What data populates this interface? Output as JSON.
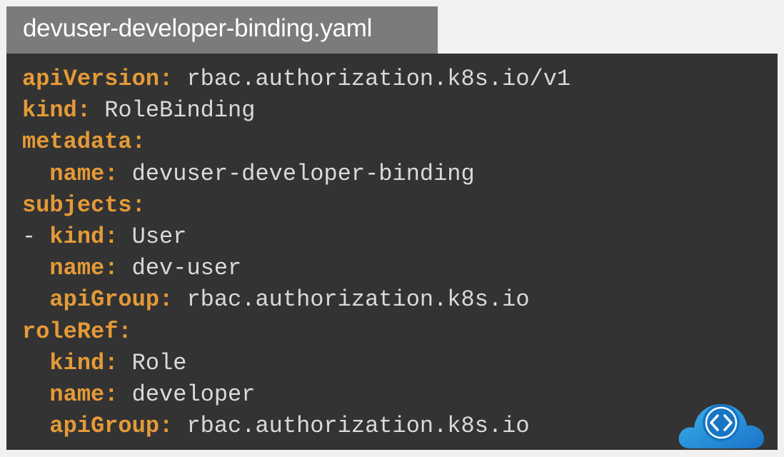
{
  "title": "devuser-developer-binding.yaml",
  "lines": [
    {
      "indent": "",
      "key": "apiVersion",
      "punct": ":",
      "value": " rbac.authorization.k8s.io/v1"
    },
    {
      "indent": "",
      "key": "kind",
      "punct": ":",
      "value": " RoleBinding"
    },
    {
      "indent": "",
      "key": "metadata",
      "punct": ":",
      "value": ""
    },
    {
      "indent": "  ",
      "key": "name",
      "punct": ":",
      "value": " devuser-developer-binding"
    },
    {
      "indent": "",
      "key": "subjects",
      "punct": ":",
      "value": ""
    },
    {
      "indent": "- ",
      "key": "kind",
      "punct": ":",
      "value": " User"
    },
    {
      "indent": "  ",
      "key": "name",
      "punct": ":",
      "value": " dev-user"
    },
    {
      "indent": "  ",
      "key": "apiGroup",
      "punct": ":",
      "value": " rbac.authorization.k8s.io"
    },
    {
      "indent": "",
      "key": "roleRef",
      "punct": ":",
      "value": ""
    },
    {
      "indent": "  ",
      "key": "kind",
      "punct": ":",
      "value": " Role"
    },
    {
      "indent": "  ",
      "key": "name",
      "punct": ":",
      "value": " developer"
    },
    {
      "indent": "  ",
      "key": "apiGroup",
      "punct": ":",
      "value": " rbac.authorization.k8s.io"
    }
  ],
  "logo": {
    "icon": "code-cloud-icon",
    "color": "#1e90d6"
  },
  "colors": {
    "key": "#e59a37",
    "value": "#dadada",
    "panel": "#333333",
    "tab": "#7b7b7b"
  }
}
